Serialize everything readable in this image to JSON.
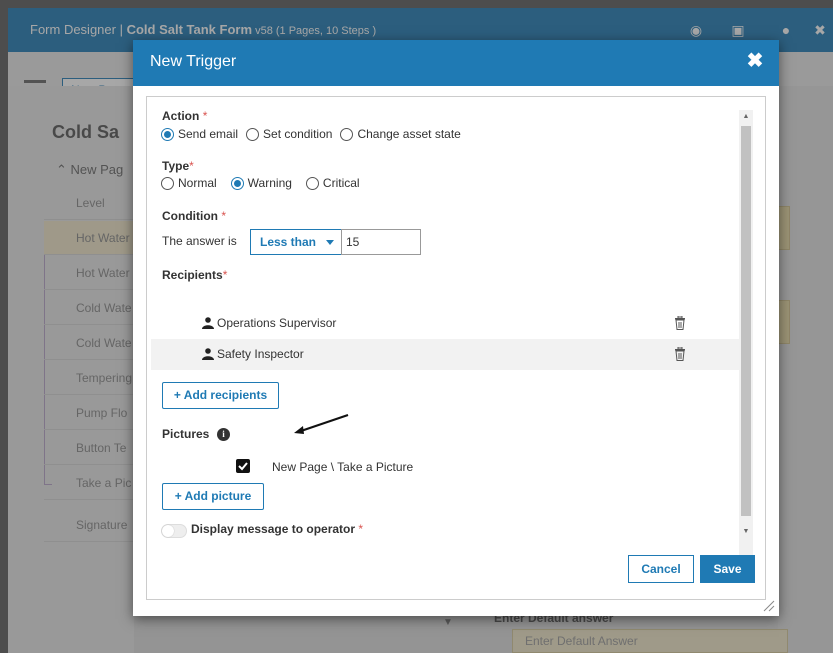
{
  "app": {
    "title_prefix": "Form Designer | ",
    "form_name": "Cold Salt Tank Form",
    "form_meta": " v58 (1 Pages, 10 Steps )",
    "new_page_label": "New Page",
    "sidebar_title": "Cold Sa",
    "sidebar_group": "New Pag",
    "sidebar_items": [
      "Level",
      "Hot Water",
      "Hot Water",
      "Cold Wate",
      "Cold Wate",
      "Tempering",
      "Pump Flo",
      "Button Te",
      "Take a Pic",
      "Signature"
    ],
    "default_answer_label": "Enter Default answer",
    "default_answer_placeholder": "Enter Default Answer"
  },
  "modal": {
    "title": "New Trigger",
    "action": {
      "label": "Action",
      "options": [
        "Send email",
        "Set condition",
        "Change asset state"
      ],
      "selected": 0
    },
    "type": {
      "label": "Type",
      "options": [
        "Normal",
        "Warning",
        "Critical"
      ],
      "selected": 1
    },
    "condition": {
      "label": "Condition",
      "prefix": "The answer is",
      "operator": "Less than",
      "value": "15"
    },
    "recipients": {
      "label": "Recipients",
      "items": [
        "Operations Supervisor",
        "Safety Inspector"
      ],
      "add_label": "+ Add recipients"
    },
    "pictures": {
      "label": "Pictures",
      "item": "New Page \\ Take a Picture",
      "checked": true,
      "add_label": "+ Add picture"
    },
    "display_message": {
      "label": "Display message to operator",
      "enabled": false
    },
    "cancel_label": "Cancel",
    "save_label": "Save"
  },
  "colors": {
    "primary": "#1f7ab4",
    "required": "#d9534f"
  }
}
